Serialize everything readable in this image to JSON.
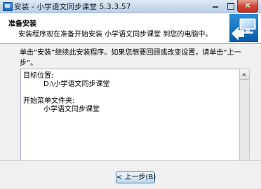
{
  "window": {
    "title": "安装 - 小学语文同步课堂  5.3.3.57",
    "close_label": "×"
  },
  "header": {
    "title": "准备安装",
    "subtitle": "安装程序现在准备开始安装 小学语文同步课堂 到您的电脑中。"
  },
  "body": {
    "instruction_line1": "单击“安装”继续此安装程序。如果您想要回顾或改变设置，请单击“上一",
    "instruction_line2": "步”。",
    "summary": {
      "dest_label": "目标位置:",
      "dest_value": "D:\\小学语文同步课堂",
      "start_menu_label": "开始菜单文件夹:",
      "start_menu_value": "小学语文同步课堂"
    }
  },
  "footer": {
    "back_label": "< 上一步(B)"
  },
  "colors": {
    "title_bar": "#c7d8ec",
    "close_button": "#d0483a",
    "body_background": "#f0f0f0",
    "button_border": "#3c7fb1"
  },
  "icons": {
    "app": "installer-app-icon",
    "header": "computer-install-icon"
  }
}
